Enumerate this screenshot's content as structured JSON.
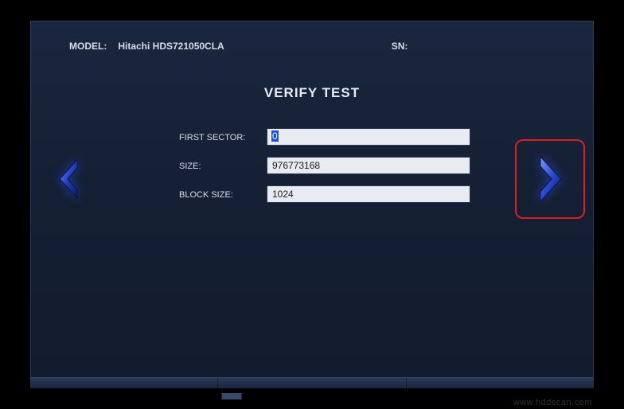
{
  "header": {
    "model_label": "MODEL:",
    "model_value": "Hitachi HDS721050CLA",
    "sn_label": "SN:",
    "sn_value": ""
  },
  "title": "VERIFY TEST",
  "form": {
    "first_sector": {
      "label": "FIRST SECTOR:",
      "value": "0"
    },
    "size": {
      "label": "SIZE:",
      "value": "976773168"
    },
    "block_size": {
      "label": "BLOCK SIZE:",
      "value": "1024"
    }
  },
  "nav": {
    "prev": "previous",
    "next": "next"
  },
  "watermark": "www.hddscan.com"
}
